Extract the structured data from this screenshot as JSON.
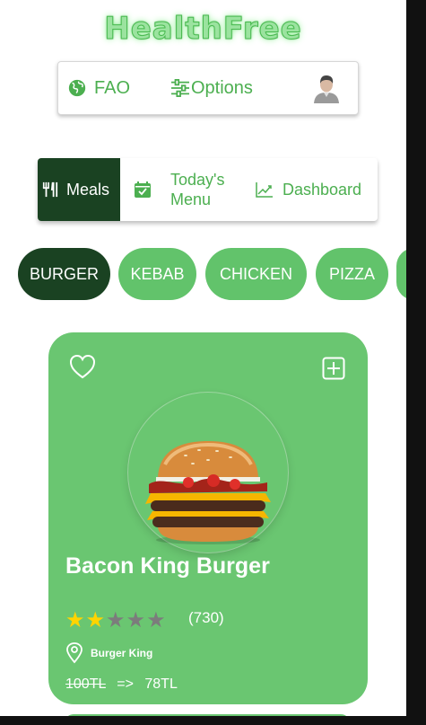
{
  "app": {
    "logo": "HealthFree"
  },
  "topbar": {
    "fao_label": "FAO",
    "options_label": "Options"
  },
  "tabs": [
    {
      "label": "Meals"
    },
    {
      "label": "Today's Menu"
    },
    {
      "label": "Dashboard"
    }
  ],
  "categories": [
    {
      "label": "BURGER",
      "selected": true
    },
    {
      "label": "KEBAB",
      "selected": false
    },
    {
      "label": "CHICKEN",
      "selected": false
    },
    {
      "label": "PIZZA",
      "selected": false
    }
  ],
  "meal_card": {
    "name": "Bacon King Burger",
    "rating": 2,
    "rating_max": 5,
    "reviews": "(730)",
    "restaurant": "Burger King",
    "old_price": "100TL",
    "arrow": "=>",
    "new_price": "78TL"
  },
  "colors": {
    "primary_green": "#6ac671",
    "dark_green": "#1a4222",
    "accent_green": "#4caf50",
    "star_on": "#ffd400",
    "star_off": "#7c7c7c"
  }
}
